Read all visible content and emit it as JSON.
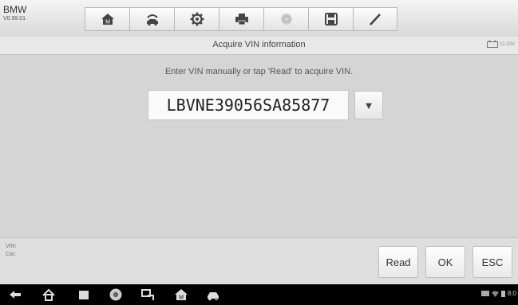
{
  "header": {
    "brand": "BMW",
    "version": "V0.99.01"
  },
  "toolbar": {
    "icons": [
      "home-icon",
      "vehicle-swap-icon",
      "settings-gear-icon",
      "print-icon",
      "help-icon",
      "save-icon",
      "edit-pen-icon"
    ]
  },
  "titlebar": {
    "title": "Acquire VIN information",
    "battery_voltage": "12.20V"
  },
  "main": {
    "instruction": "Enter VIN manually or tap 'Read' to acquire VIN.",
    "vin_value": "LBVNE39056SA85877",
    "dropdown_symbol": "▼"
  },
  "bottom": {
    "vin_label": "VIN:",
    "car_label": "Car:",
    "read_label": "Read",
    "ok_label": "OK",
    "esc_label": "ESC"
  },
  "navbar": {
    "icons": [
      "back-icon",
      "android-home-icon",
      "recent-apps-icon",
      "chrome-icon",
      "remote-icon",
      "diagnostics-home-icon",
      "car-icon"
    ],
    "clock": "8:0"
  },
  "colors": {
    "toolbar_icon": "#444444",
    "background": "#d7d7d7",
    "navbar": "#000000"
  }
}
